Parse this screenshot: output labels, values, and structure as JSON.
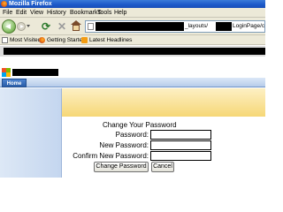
{
  "window": {
    "title": "Mozilla Firefox"
  },
  "menu": [
    "File",
    "Edit",
    "View",
    "History",
    "Bookmarks",
    "Tools",
    "Help"
  ],
  "address": {
    "seg1": "_layouts/",
    "seg2": "LoginPage/changepassword.aspx"
  },
  "bookmarks": [
    {
      "label": "Most Visited",
      "icon": "page-icon"
    },
    {
      "label": "Getting Started",
      "icon": "firefox-icon"
    },
    {
      "label": "Latest Headlines",
      "icon": "rss-icon"
    }
  ],
  "site": {
    "home_tab": "Home"
  },
  "form": {
    "title": "Change Your Password",
    "password_label": "Password:",
    "new_password_label": "New Password:",
    "confirm_label": "Confirm New Password:",
    "change_button": "Change Password",
    "cancel_button": "Cancel"
  },
  "colors": {
    "tab_blue": "#2a5da8",
    "banner_orange": "#f6d776",
    "titlebar": "#1c58c8"
  }
}
